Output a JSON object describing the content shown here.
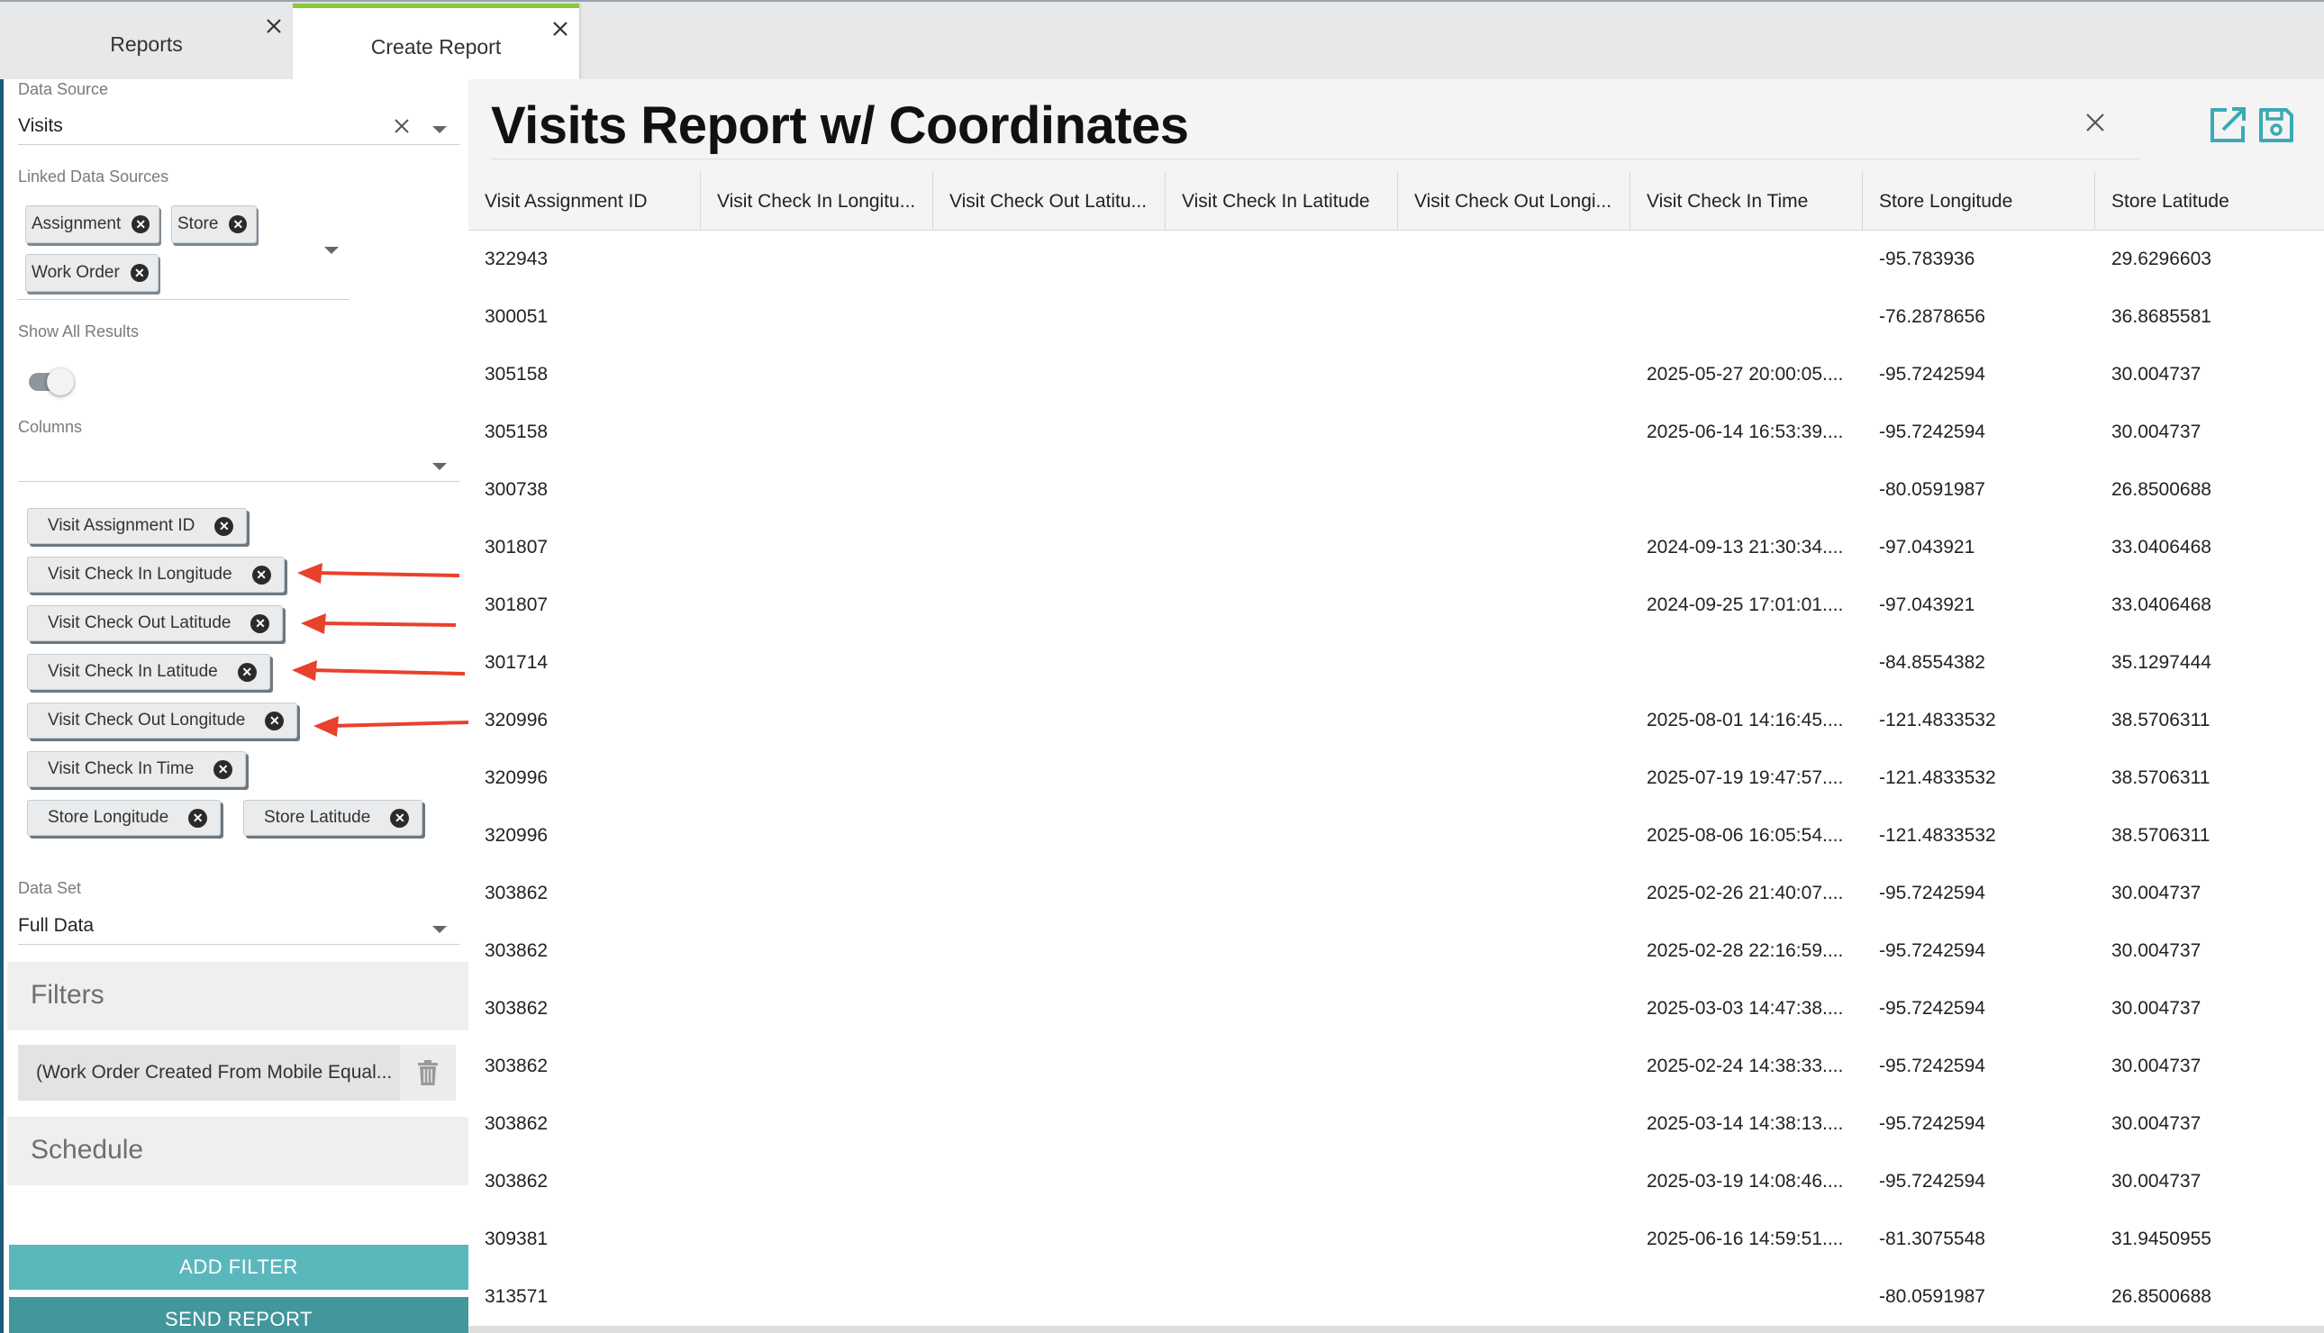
{
  "tabs": [
    {
      "label": "Reports"
    },
    {
      "label": "Create Report"
    }
  ],
  "sidebar": {
    "data_source": {
      "label": "Data Source",
      "value": "Visits"
    },
    "linked_sources": {
      "label": "Linked Data Sources",
      "chips": [
        "Assignment",
        "Store",
        "Work Order"
      ]
    },
    "show_all": {
      "label": "Show All Results",
      "on": false
    },
    "columns": {
      "label": "Columns",
      "chips": [
        "Visit Assignment ID",
        "Visit Check In Longitude",
        "Visit Check Out Latitude",
        "Visit Check In Latitude",
        "Visit Check Out Longitude",
        "Visit Check In Time",
        "Store Longitude",
        "Store Latitude"
      ]
    },
    "data_set": {
      "label": "Data Set",
      "value": "Full Data"
    },
    "filters": {
      "title": "Filters",
      "items": [
        "(Work Order Created From Mobile Equal..."
      ]
    },
    "schedule": {
      "title": "Schedule"
    },
    "buttons": {
      "add_filter": "ADD FILTER",
      "send_report": "SEND REPORT"
    }
  },
  "report": {
    "title": "Visits Report w/ Coordinates",
    "columns": [
      "Visit Assignment ID",
      "Visit Check In Longitu...",
      "Visit Check Out Latitu...",
      "Visit Check In Latitude",
      "Visit Check Out Longi...",
      "Visit Check In Time",
      "Store Longitude",
      "Store Latitude"
    ],
    "rows": [
      [
        "322943",
        "",
        "",
        "",
        "",
        "",
        "-95.783936",
        "29.6296603"
      ],
      [
        "300051",
        "",
        "",
        "",
        "",
        "",
        "-76.2878656",
        "36.8685581"
      ],
      [
        "305158",
        "",
        "",
        "",
        "",
        "2025-05-27 20:00:05....",
        "-95.7242594",
        "30.004737"
      ],
      [
        "305158",
        "",
        "",
        "",
        "",
        "2025-06-14 16:53:39....",
        "-95.7242594",
        "30.004737"
      ],
      [
        "300738",
        "",
        "",
        "",
        "",
        "",
        "-80.0591987",
        "26.8500688"
      ],
      [
        "301807",
        "",
        "",
        "",
        "",
        "2024-09-13 21:30:34....",
        "-97.043921",
        "33.0406468"
      ],
      [
        "301807",
        "",
        "",
        "",
        "",
        "2024-09-25 17:01:01....",
        "-97.043921",
        "33.0406468"
      ],
      [
        "301714",
        "",
        "",
        "",
        "",
        "",
        "-84.8554382",
        "35.1297444"
      ],
      [
        "320996",
        "",
        "",
        "",
        "",
        "2025-08-01 14:16:45....",
        "-121.4833532",
        "38.5706311"
      ],
      [
        "320996",
        "",
        "",
        "",
        "",
        "2025-07-19 19:47:57....",
        "-121.4833532",
        "38.5706311"
      ],
      [
        "320996",
        "",
        "",
        "",
        "",
        "2025-08-06 16:05:54....",
        "-121.4833532",
        "38.5706311"
      ],
      [
        "303862",
        "",
        "",
        "",
        "",
        "2025-02-26 21:40:07....",
        "-95.7242594",
        "30.004737"
      ],
      [
        "303862",
        "",
        "",
        "",
        "",
        "2025-02-28 22:16:59....",
        "-95.7242594",
        "30.004737"
      ],
      [
        "303862",
        "",
        "",
        "",
        "",
        "2025-03-03 14:47:38....",
        "-95.7242594",
        "30.004737"
      ],
      [
        "303862",
        "",
        "",
        "",
        "",
        "2025-02-24 14:38:33....",
        "-95.7242594",
        "30.004737"
      ],
      [
        "303862",
        "",
        "",
        "",
        "",
        "2025-03-14 14:38:13....",
        "-95.7242594",
        "30.004737"
      ],
      [
        "303862",
        "",
        "",
        "",
        "",
        "2025-03-19 14:08:46....",
        "-95.7242594",
        "30.004737"
      ],
      [
        "309381",
        "",
        "",
        "",
        "",
        "2025-06-16 14:59:51....",
        "-81.3075548",
        "31.9450955"
      ],
      [
        "313571",
        "",
        "",
        "",
        "",
        "",
        "-80.0591987",
        "26.8500688"
      ]
    ]
  },
  "colors": {
    "accent_teal": "#5ab8bd",
    "accent_teal_dark": "#42979c",
    "active_tab_green": "#8cc63f",
    "annotation_arrow": "#e8412c",
    "icon_teal": "#3ba9b6"
  }
}
